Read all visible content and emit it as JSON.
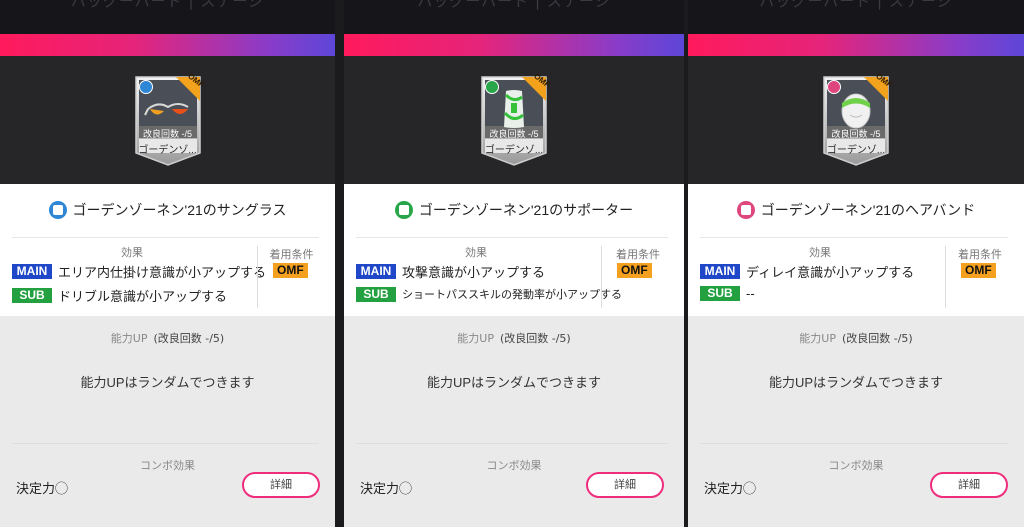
{
  "colors": {
    "main_tag": "#1f47c8",
    "sub_tag": "#23a040",
    "position_badge": "#f5a01e",
    "detail_button_border": "#ef2d7c",
    "gradient_start": "#ff1a5c",
    "gradient_end": "#5d46d8"
  },
  "panels": [
    {
      "top_title": "バッグーバード | ステージ",
      "card": {
        "position": "OMF",
        "refine": "改良回数 -/5",
        "name": "ゴーデンゾ...",
        "art_icon": "sunglasses-icon",
        "category_color": "#2e86d6"
      },
      "title": "ゴーデンゾーネン'21のサングラス",
      "effects_heading": "効果",
      "main_tag": "MAIN",
      "main_effect": "エリア内仕掛け意識が小アップする",
      "sub_tag": "SUB",
      "sub_effect": "ドリブル意識が小アップする",
      "condition_heading": "着用条件",
      "condition": "OMF",
      "up_heading": "能力UP",
      "up_refine": "(改良回数 -/5)",
      "up_body": "能力UPはランダムでつきます",
      "combo_heading": "コンボ効果",
      "combo_text": "決定力◯",
      "detail_button": "詳細"
    },
    {
      "top_title": "バッグーバード | ステージ",
      "card": {
        "position": "OMF",
        "refine": "改良回数 -/5",
        "name": "ゴーデンゾ...",
        "art_icon": "supporter-icon",
        "category_color": "#2aa64a"
      },
      "title": "ゴーデンゾーネン'21のサポーター",
      "effects_heading": "効果",
      "main_tag": "MAIN",
      "main_effect": "攻撃意識が小アップする",
      "sub_tag": "SUB",
      "sub_effect": "ショートパススキルの発動率が小アップする",
      "condition_heading": "着用条件",
      "condition": "OMF",
      "up_heading": "能力UP",
      "up_refine": "(改良回数 -/5)",
      "up_body": "能力UPはランダムでつきます",
      "combo_heading": "コンボ効果",
      "combo_text": "決定力◯",
      "detail_button": "詳細"
    },
    {
      "top_title": "バッグーバード | ステージ",
      "card": {
        "position": "OMF",
        "refine": "改良回数 -/5",
        "name": "ゴーデンゾ...",
        "art_icon": "headband-icon",
        "category_color": "#e0467e"
      },
      "title": "ゴーデンゾーネン'21のヘアバンド",
      "effects_heading": "効果",
      "main_tag": "MAIN",
      "main_effect": "ディレイ意識が小アップする",
      "sub_tag": "SUB",
      "sub_effect": "--",
      "condition_heading": "着用条件",
      "condition": "OMF",
      "up_heading": "能力UP",
      "up_refine": "(改良回数 -/5)",
      "up_body": "能力UPはランダムでつきます",
      "combo_heading": "コンボ効果",
      "combo_text": "決定力◯",
      "detail_button": "詳細"
    }
  ]
}
